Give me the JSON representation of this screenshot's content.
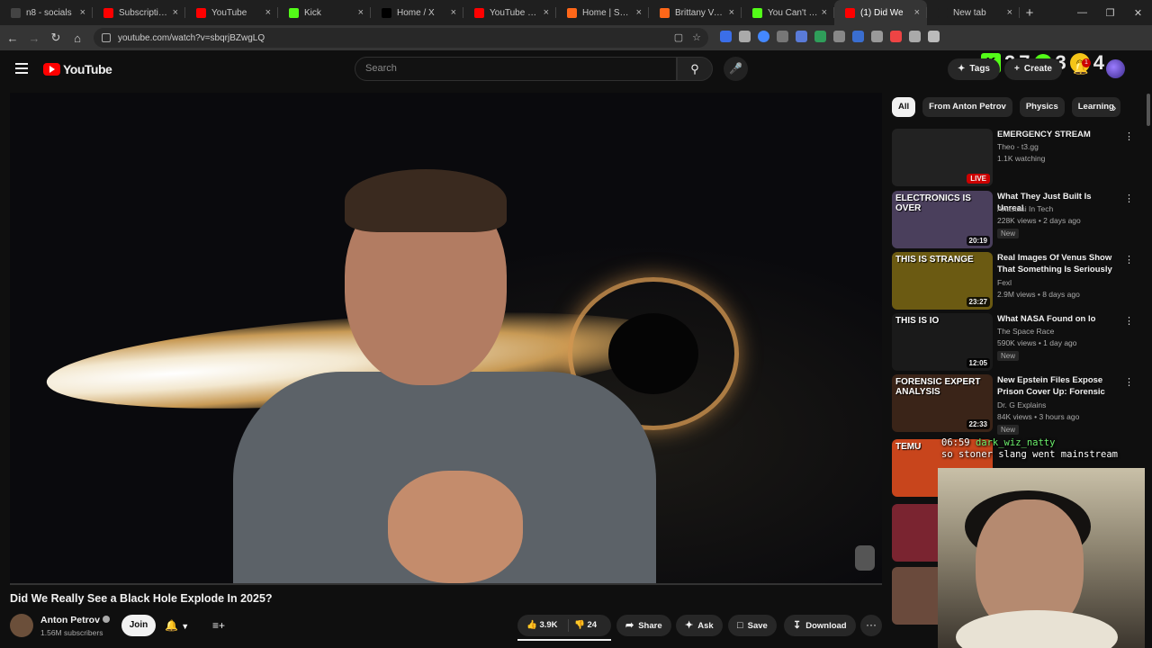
{
  "browser": {
    "tabs": [
      {
        "title": "n8 - socials",
        "color": "#444444"
      },
      {
        "title": "Subscriptions -",
        "color": "#ff0000"
      },
      {
        "title": "YouTube",
        "color": "#ff0000"
      },
      {
        "title": "Kick",
        "color": "#53fc18"
      },
      {
        "title": "Home / X",
        "color": "#000000"
      },
      {
        "title": "YouTube Music",
        "color": "#ff0000"
      },
      {
        "title": "Home | Substa",
        "color": "#ff6719"
      },
      {
        "title": "Brittany Venti",
        "color": "#ff6719"
      },
      {
        "title": "You Can't Stop",
        "color": "#53fc18"
      },
      {
        "title": "(1) Did We",
        "color": "#ff0000"
      },
      {
        "title": "New tab",
        "color": "#1f1f1f"
      }
    ],
    "active_tab": 9,
    "new_tab_label": "+",
    "url": "youtube.com/watch?v=sbqrjBZwgLQ",
    "overlay_numbers": [
      "2",
      "7",
      "3",
      "4"
    ]
  },
  "youtube": {
    "logo_text": "YouTube",
    "search_placeholder": "Search",
    "tags_label": "Tags",
    "create_label": "Create",
    "notification_count": "1"
  },
  "video": {
    "title": "Did We Really See a Black Hole Explode In 2025?",
    "channel": "Anton Petrov",
    "subscribers": "1.56M subscribers",
    "join_label": "Join",
    "likes": "3.9K",
    "dislikes": "24",
    "share_label": "Share",
    "ask_label": "Ask",
    "save_label": "Save",
    "download_label": "Download",
    "more_label": "···"
  },
  "sidebar": {
    "chips": [
      "All",
      "From Anton Petrov",
      "Physics",
      "Learning"
    ],
    "recommendations": [
      {
        "title": "EMERGENCY STREAM",
        "channel": "Theo - t3.gg",
        "meta": "1.1K watching",
        "badge": "LIVE",
        "new": "",
        "thumb_bg": "#222222",
        "thumb_text": ""
      },
      {
        "title": "What They Just Built Is Unreal",
        "channel": "Anastasi In Tech",
        "meta": "228K views • 2 days ago",
        "badge": "20:19",
        "new": "New",
        "thumb_bg": "#4a3f5c",
        "thumb_text": "ELECTRONICS IS OVER"
      },
      {
        "title": "Real Images Of Venus Show That Something Is Seriously O...",
        "channel": "Fexl",
        "meta": "2.9M views • 8 days ago",
        "badge": "23:27",
        "new": "",
        "thumb_bg": "#6b5a12",
        "thumb_text": "THIS IS STRANGE"
      },
      {
        "title": "What NASA Found on Io",
        "channel": "The Space Race",
        "meta": "590K views • 1 day ago",
        "badge": "12:05",
        "new": "New",
        "thumb_bg": "#1a1a1a",
        "thumb_text": "THIS IS IO"
      },
      {
        "title": "New Epstein Files Expose Prison Cover Up: Forensic ...",
        "channel": "Dr. G Explains",
        "meta": "84K views • 3 hours ago",
        "badge": "22:33",
        "new": "New",
        "thumb_bg": "#3a2418",
        "thumb_text": "FORENSIC EXPERT ANALYSIS"
      },
      {
        "title": "",
        "channel": "",
        "meta": "",
        "badge": "",
        "new": "",
        "thumb_bg": "#c8451c",
        "thumb_text": "TEMU"
      },
      {
        "title": "",
        "channel": "",
        "meta": "",
        "badge": "",
        "new": "",
        "thumb_bg": "#7a2430",
        "thumb_text": ""
      },
      {
        "title": "",
        "channel": "",
        "meta": "",
        "badge": "",
        "new": "",
        "thumb_bg": "#6a4a3c",
        "thumb_text": ""
      }
    ]
  },
  "stream_overlay": {
    "line1_user": "dark_wiz_natty",
    "line1_prefix": "06:59",
    "line2": "so stoner slang went mainstream"
  }
}
